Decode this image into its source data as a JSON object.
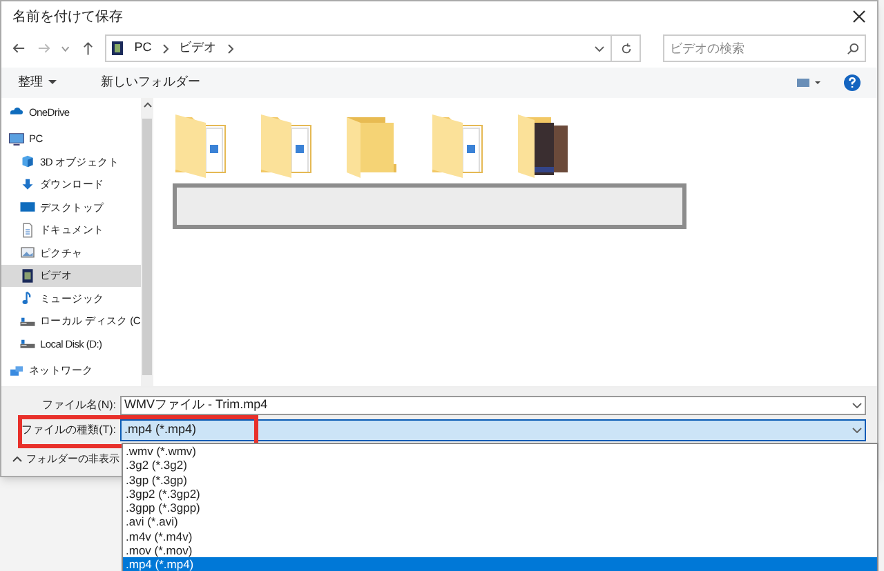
{
  "window": {
    "title": "名前を付けて保存"
  },
  "breadcrumb": [
    "PC",
    "ビデオ"
  ],
  "search": {
    "placeholder": "ビデオの検索"
  },
  "toolbar": {
    "organize": "整理",
    "new_folder": "新しいフォルダー"
  },
  "sidebar": {
    "items": [
      {
        "label": "OneDrive",
        "kind": "cloud",
        "selected": false
      },
      {
        "label": "PC",
        "kind": "pc",
        "selected": false,
        "children": [
          {
            "label": "3D オブジェクト",
            "kind": "cube",
            "selected": false
          },
          {
            "label": "ダウンロード",
            "kind": "download",
            "selected": false
          },
          {
            "label": "デスクトップ",
            "kind": "desktop",
            "selected": false
          },
          {
            "label": "ドキュメント",
            "kind": "document",
            "selected": false
          },
          {
            "label": "ピクチャ",
            "kind": "picture",
            "selected": false
          },
          {
            "label": "ビデオ",
            "kind": "video",
            "selected": true
          },
          {
            "label": "ミュージック",
            "kind": "music",
            "selected": false
          },
          {
            "label": "ローカル ディスク (C",
            "kind": "drive",
            "selected": false
          },
          {
            "label": "Local Disk (D:)",
            "kind": "drive",
            "selected": false
          }
        ]
      },
      {
        "label": "ネットワーク",
        "kind": "network",
        "selected": false
      }
    ]
  },
  "folders": [
    {
      "kind": "documents"
    },
    {
      "kind": "documents"
    },
    {
      "kind": "empty"
    },
    {
      "kind": "documents"
    },
    {
      "kind": "photo"
    }
  ],
  "file_name": {
    "label": "ファイル名(N):",
    "value": "WMVファイル - Trim.mp4"
  },
  "file_type": {
    "label": "ファイルの種類(T):",
    "value": ".mp4 (*.mp4)",
    "options": [
      {
        "label": ".wmv (*.wmv)",
        "selected": false
      },
      {
        "label": ".3g2 (*.3g2)",
        "selected": false
      },
      {
        "label": ".3gp (*.3gp)",
        "selected": false
      },
      {
        "label": ".3gp2 (*.3gp2)",
        "selected": false
      },
      {
        "label": ".3gpp (*.3gpp)",
        "selected": false
      },
      {
        "label": ".avi (*.avi)",
        "selected": false
      },
      {
        "label": ".m4v (*.m4v)",
        "selected": false
      },
      {
        "label": ".mov (*.mov)",
        "selected": false
      },
      {
        "label": ".mp4 (*.mp4)",
        "selected": true
      }
    ]
  },
  "hide_folders": "フォルダーの非表示"
}
